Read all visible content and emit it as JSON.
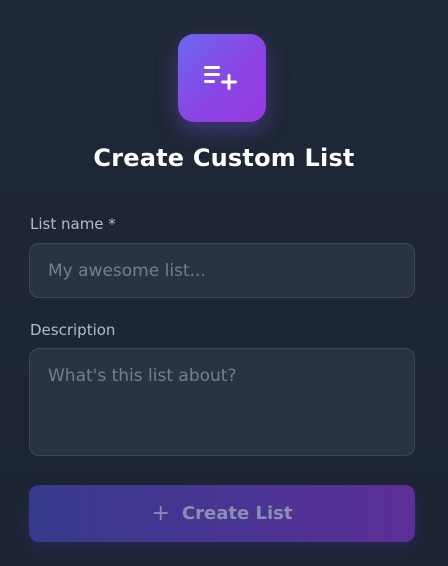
{
  "header": {
    "icon": "list-add-icon",
    "title": "Create Custom List"
  },
  "form": {
    "name_label": "List name *",
    "name_placeholder": "My awesome list...",
    "name_value": "",
    "description_label": "Description",
    "description_placeholder": "What's this list about?",
    "description_value": ""
  },
  "actions": {
    "create_icon": "plus-icon",
    "create_icon_glyph": "+",
    "create_label": "Create List"
  },
  "colors": {
    "background": "#1d2633",
    "accent_start": "#6d68f0",
    "accent_end": "#9b37e0",
    "input_background": "#2a3342"
  }
}
